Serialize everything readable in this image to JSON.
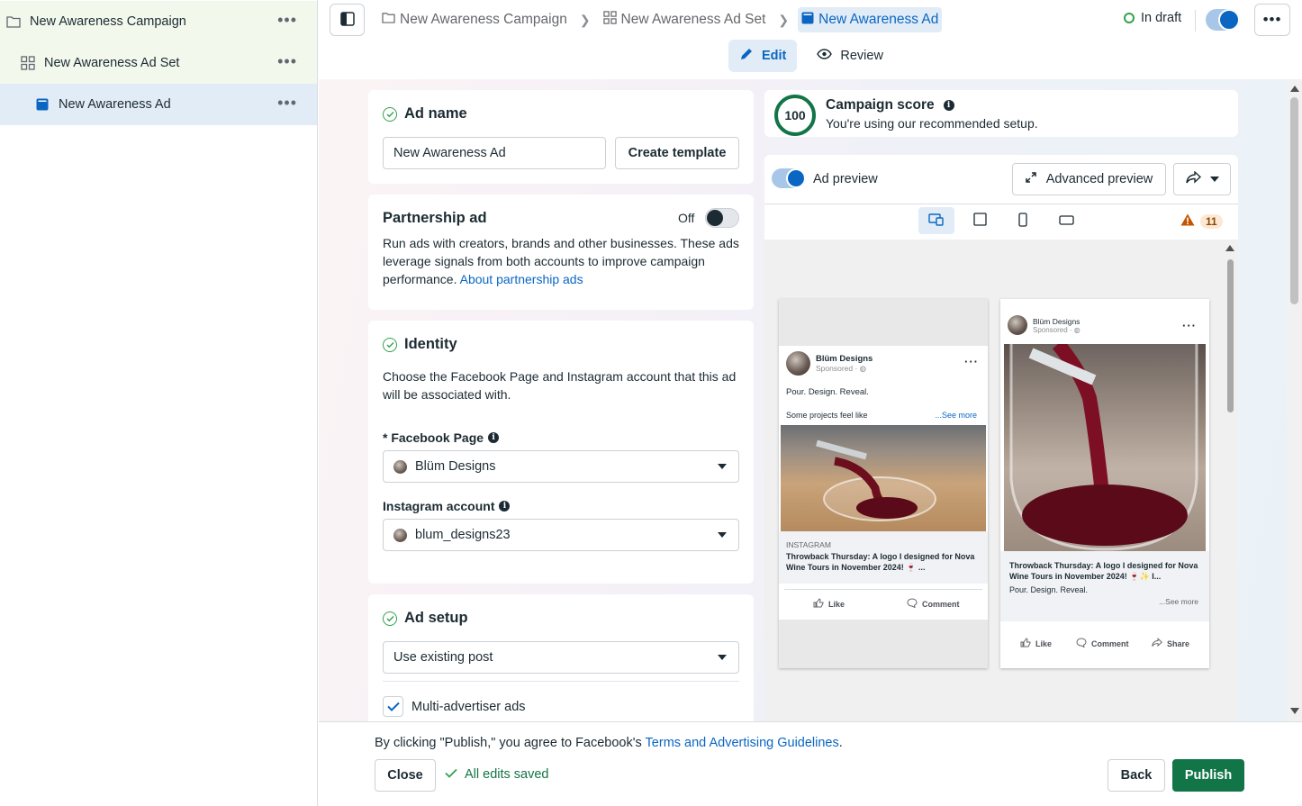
{
  "sidebar": {
    "items": [
      {
        "label": "New Awareness Campaign",
        "icon": "folder-icon"
      },
      {
        "label": "New Awareness Ad Set",
        "icon": "grid-icon"
      },
      {
        "label": "New Awareness Ad",
        "icon": "ad-doc-icon"
      }
    ],
    "more_label": "•••"
  },
  "header": {
    "breadcrumbs": [
      "New Awareness Campaign",
      "New Awareness Ad Set",
      "New Awareness Ad"
    ],
    "status": "In draft",
    "more_label": "•••",
    "tabs": [
      {
        "label": "Edit"
      },
      {
        "label": "Review"
      }
    ]
  },
  "ad_name": {
    "title": "Ad name",
    "value": "New Awareness Ad",
    "create_template_label": "Create template"
  },
  "partnership": {
    "title": "Partnership ad",
    "toggle_label": "Off",
    "description": "Run ads with creators, brands and other businesses. These ads leverage signals from both accounts to improve campaign performance.",
    "link": "About partnership ads"
  },
  "identity": {
    "title": "Identity",
    "description": "Choose the Facebook Page and Instagram account that this ad will be associated with.",
    "facebook_label": "* Facebook Page",
    "facebook_value": "Blüm Designs",
    "instagram_label": "Instagram account",
    "instagram_value": "blum_designs23"
  },
  "ad_setup": {
    "title": "Ad setup",
    "select_value": "Use existing post",
    "checkbox_label": "Multi-advertiser ads",
    "checkbox_checked": true
  },
  "score": {
    "value": "100",
    "title": "Campaign score",
    "subtitle": "You're using our recommended setup."
  },
  "preview": {
    "toggle_label": "Ad preview",
    "advanced_label": "Advanced preview",
    "warning_count": "11",
    "left_card": {
      "name": "Blüm Designs",
      "sponsored": "Sponsored · ◍",
      "caption": "Pour. Design. Reveal.",
      "teaser": "Some projects feel like",
      "see_more": "...See more",
      "source": "INSTAGRAM",
      "headline": "Throwback Thursday: A logo I designed for Nova Wine Tours in November 2024! 🍷 ...",
      "like": "Like",
      "comment": "Comment"
    },
    "right_card": {
      "name": "Blüm Designs",
      "sponsored": "Sponsored · ◍",
      "headline": "Throwback Thursday: A logo I designed for Nova Wine Tours in November 2024! 🍷✨ I...",
      "caption": "Pour. Design. Reveal.",
      "see_more": "...See more",
      "like": "Like",
      "comment": "Comment",
      "share": "Share"
    }
  },
  "footer": {
    "agreement_prefix": "By clicking \"Publish,\" you agree to Facebook's ",
    "agreement_link": "Terms and Advertising Guidelines",
    "agreement_suffix": ".",
    "close_label": "Close",
    "saved_label": "All edits saved",
    "back_label": "Back",
    "publish_label": "Publish"
  },
  "colors": {
    "accent": "#0a66c2",
    "publish": "#127547",
    "success": "#31a24c",
    "warning": "#c45500"
  }
}
